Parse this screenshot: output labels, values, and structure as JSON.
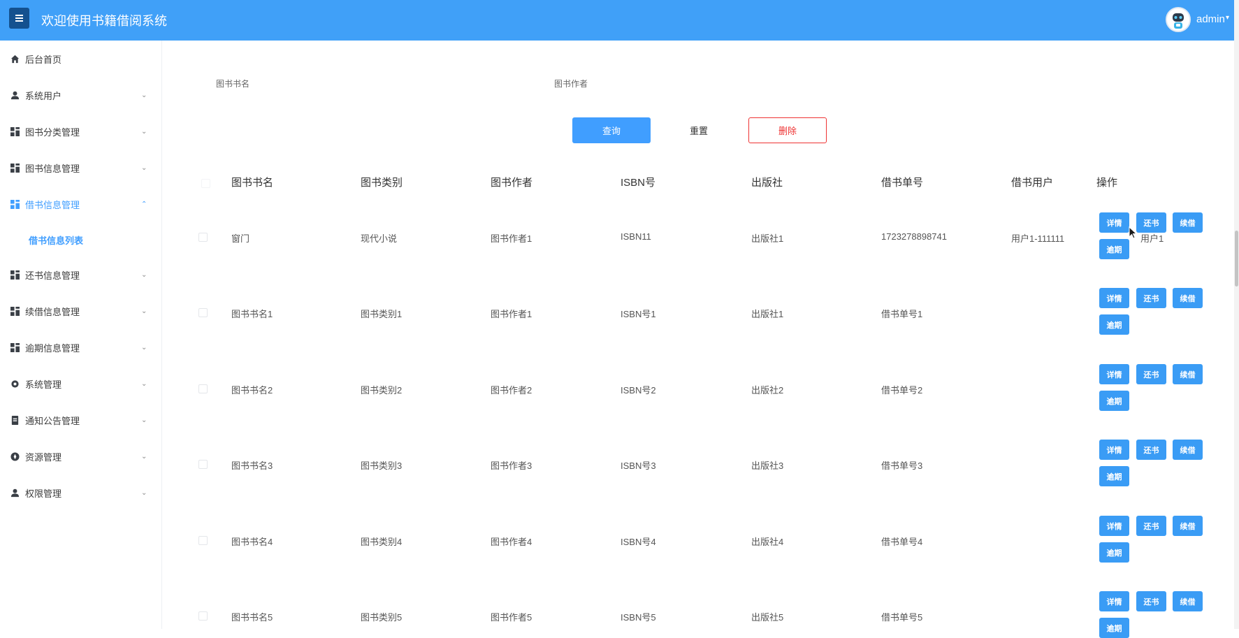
{
  "header": {
    "menu_icon": "hamburger-icon",
    "title": "欢迎使用书籍借阅系统",
    "user": "admin",
    "user_caret_icon": "chevron-down-icon",
    "brand_color": "#40a0f8"
  },
  "sidebar": {
    "items": [
      {
        "label": "后台首页",
        "icon": "home-icon"
      },
      {
        "label": "系统用户",
        "icon": "user-icon"
      },
      {
        "label": "图书分类管理",
        "icon": "grid-icon"
      },
      {
        "label": "图书信息管理",
        "icon": "grid-icon"
      },
      {
        "label": "借书信息管理",
        "icon": "grid-icon"
      },
      {
        "label": "还书信息管理",
        "icon": "grid-icon"
      },
      {
        "label": "续借信息管理",
        "icon": "grid-icon"
      },
      {
        "label": "逾期信息管理",
        "icon": "grid-icon"
      },
      {
        "label": "系统管理",
        "icon": "gear-icon"
      },
      {
        "label": "通知公告管理",
        "icon": "document-icon"
      },
      {
        "label": "资源管理",
        "icon": "compass-icon"
      },
      {
        "label": "权限管理",
        "icon": "user-icon"
      }
    ],
    "sub_item": "借书信息列表",
    "active_color": "#409eff"
  },
  "filters": {
    "book_name_label": "图书书名",
    "author_label": "图书作者"
  },
  "actions": {
    "query": "查询",
    "reset": "重置",
    "delete": "删除"
  },
  "table": {
    "headers": [
      "图书书名",
      "图书类别",
      "图书作者",
      "ISBN号",
      "出版社",
      "借书单号",
      "借书用户",
      "操作"
    ],
    "rows": [
      [
        "窗门",
        "现代小说",
        "图书作者1",
        "ISBN11",
        "出版社1",
        "1723278898741",
        "用户1-111111"
      ],
      [
        "图书书名1",
        "图书类别1",
        "图书作者1",
        "ISBN号1",
        "出版社1",
        "借书单号1",
        ""
      ],
      [
        "图书书名2",
        "图书类别2",
        "图书作者2",
        "ISBN号2",
        "出版社2",
        "借书单号2",
        ""
      ],
      [
        "图书书名3",
        "图书类别3",
        "图书作者3",
        "ISBN号3",
        "出版社3",
        "借书单号3",
        ""
      ],
      [
        "图书书名4",
        "图书类别4",
        "图书作者4",
        "ISBN号4",
        "出版社4",
        "借书单号4",
        ""
      ],
      [
        "图书书名5",
        "图书类别5",
        "图书作者5",
        "ISBN号5",
        "出版社5",
        "借书单号5",
        ""
      ]
    ],
    "overflow_text": "用户1",
    "row_actions": {
      "detail": "详情",
      "return": "还书",
      "renew": "续借",
      "overdue": "逾期"
    }
  }
}
